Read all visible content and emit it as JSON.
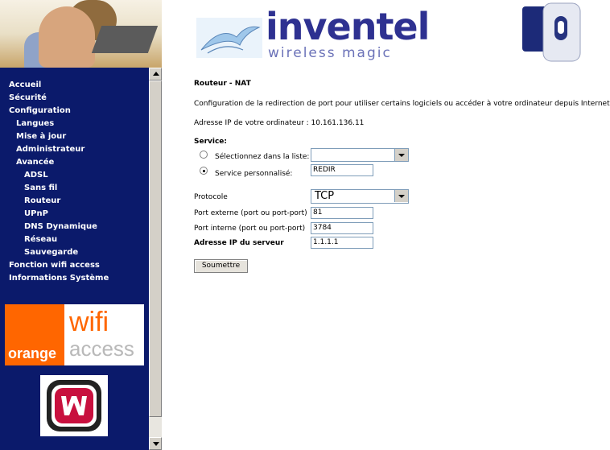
{
  "header": {
    "brand": "inventel",
    "tagline": "wireless magic"
  },
  "sidebar": {
    "items": [
      {
        "label": "Accueil",
        "level": 0
      },
      {
        "label": "Sécurité",
        "level": 0
      },
      {
        "label": "Configuration",
        "level": 0
      },
      {
        "label": "Langues",
        "level": 1
      },
      {
        "label": "Mise à jour",
        "level": 1
      },
      {
        "label": "Administrateur",
        "level": 1
      },
      {
        "label": "Avancée",
        "level": 1
      },
      {
        "label": "ADSL",
        "level": 2
      },
      {
        "label": "Sans fil",
        "level": 2
      },
      {
        "label": "Routeur",
        "level": 2
      },
      {
        "label": "UPnP",
        "level": 2
      },
      {
        "label": "DNS Dynamique",
        "level": 2
      },
      {
        "label": "Réseau",
        "level": 2
      },
      {
        "label": "Sauvegarde",
        "level": 2
      },
      {
        "label": "Fonction wifi access",
        "level": 0
      },
      {
        "label": "Informations Système",
        "level": 0
      }
    ],
    "banner": {
      "orange": "orange",
      "wifi": "wifi",
      "access": "access"
    }
  },
  "main": {
    "title": "Routeur - NAT",
    "intro": "Configuration de la redirection de port pour utiliser certains logiciels ou accéder à votre ordinateur depuis Internet.",
    "ip_label": "Adresse IP de votre ordinateur : 10.161.136.11",
    "service": {
      "label": "Service:",
      "option_list": "Sélectionnez dans la liste:",
      "option_custom": "Service personnalisé:",
      "custom_value": "REDIR",
      "list_value": ""
    },
    "protocol": {
      "label": "Protocole",
      "value": "TCP"
    },
    "external_port": {
      "label": "Port externe (port ou port-port)",
      "value": "81"
    },
    "internal_port": {
      "label": "Port interne (port ou port-port)",
      "value": "3784"
    },
    "server_ip": {
      "label": "Adresse IP du serveur",
      "value": "1.1.1.1"
    },
    "submit": "Soumettre"
  }
}
